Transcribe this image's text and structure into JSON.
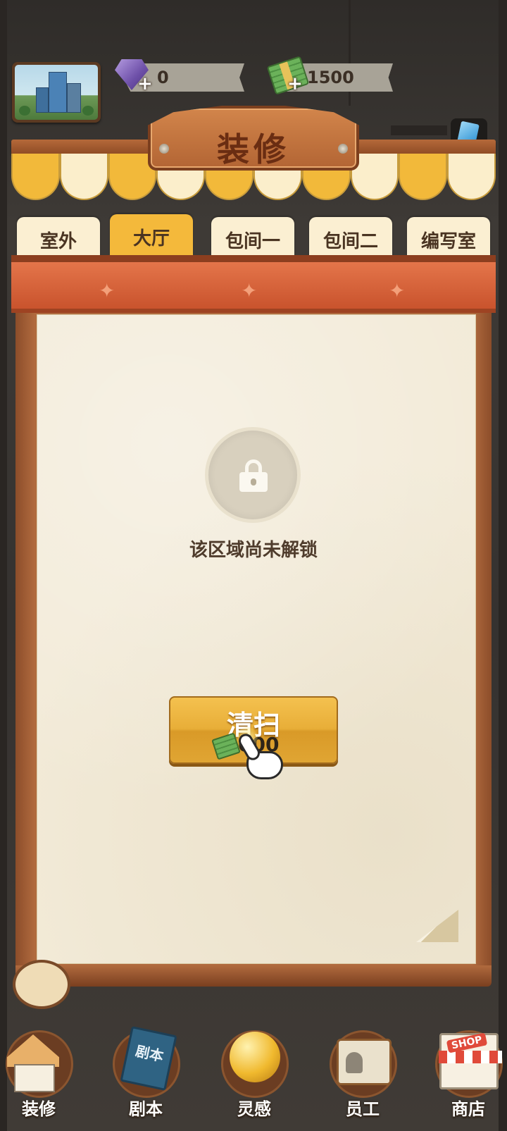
{
  "resources": {
    "gems": "0",
    "cash": "1500",
    "plus": "+"
  },
  "title": "装修",
  "tabs": [
    {
      "label": "室外",
      "active": false
    },
    {
      "label": "大厅",
      "active": true
    },
    {
      "label": "包间一",
      "active": false
    },
    {
      "label": "包间二",
      "active": false
    },
    {
      "label": "编写室",
      "active": false
    }
  ],
  "panel": {
    "locked_message": "该区域尚未解锁",
    "clean_button": {
      "label": "清扫",
      "cost": "000"
    }
  },
  "bottom_nav": [
    {
      "label": "装修",
      "icon": "house-icon"
    },
    {
      "label": "剧本",
      "icon": "script-book-icon",
      "pic_text": "剧本"
    },
    {
      "label": "灵感",
      "icon": "lightbulb-icon"
    },
    {
      "label": "员工",
      "icon": "staff-badge-icon"
    },
    {
      "label": "商店",
      "icon": "shop-icon",
      "pic_text": "SHOP"
    }
  ],
  "colors": {
    "tab_active": "#f4b93b",
    "tab_inactive": "#fbefd2",
    "panel_header": "#d9603a",
    "paper": "#f2ead7",
    "button": "#e8ae38"
  }
}
